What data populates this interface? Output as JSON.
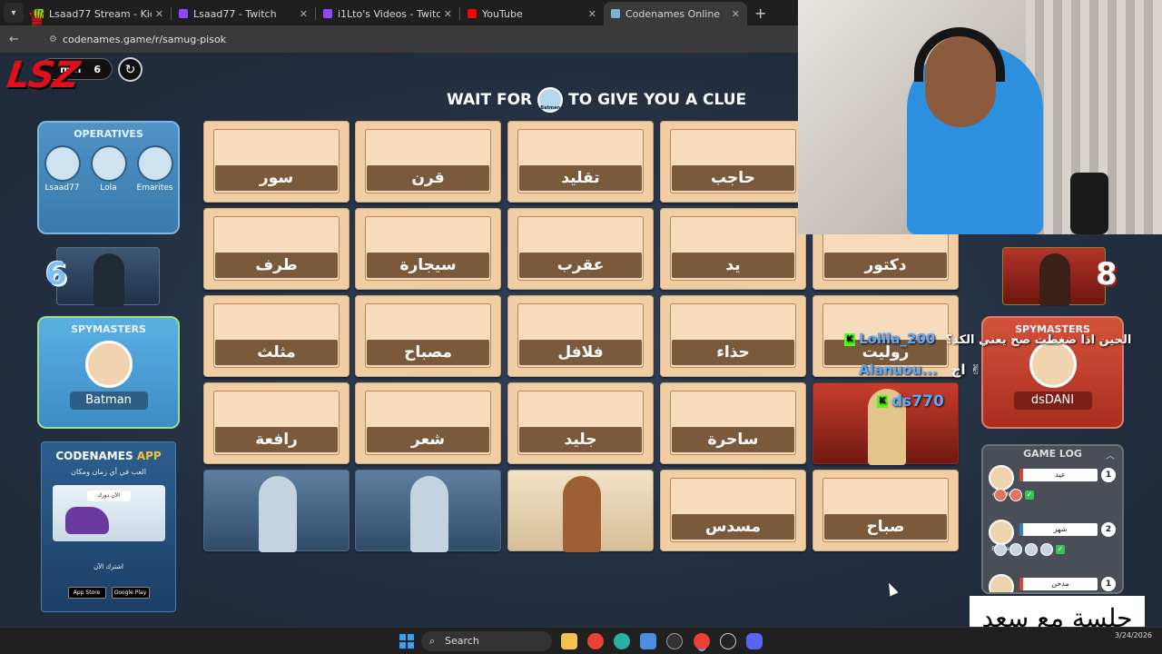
{
  "browser": {
    "tabs": [
      {
        "label": "Lsaad77 Stream - Kick Dashboo",
        "color": "#53fc18",
        "active": false
      },
      {
        "label": "Lsaad77 - Twitch",
        "color": "#9146ff",
        "active": false
      },
      {
        "label": "i1Lto's Videos - Twitch",
        "color": "#9146ff",
        "active": false
      },
      {
        "label": "YouTube",
        "color": "#ff0000",
        "active": false
      },
      {
        "label": "Codenames Online",
        "color": "#7bb3d6",
        "active": true
      }
    ],
    "url": "codenames.game/r/samug-pisok"
  },
  "stream_logo": "LSZ",
  "timer": {
    "label": "min",
    "value": "6"
  },
  "clue_banner": {
    "prefix": "WAIT FOR",
    "spymaster": "Batman",
    "suffix": "TO GIVE YOU A CLUE"
  },
  "blue_team": {
    "operatives_title": "OPERATIVES",
    "operatives": [
      "Lsaad77",
      "Lola",
      "Emarites"
    ],
    "score": "6",
    "spymasters_title": "SPYMASTERS",
    "spymaster": "Batman"
  },
  "red_team": {
    "score": "8",
    "spymasters_title": "SPYMASTERS",
    "spymaster": "dsDANI"
  },
  "promo": {
    "title_a": "CODENAMES",
    "title_b": "APP",
    "subtitle": "العب في أي زمان ومكان",
    "card_pill": "الآن دورك",
    "cta": "اشترك الآن",
    "store_a": "App Store",
    "store_b": "Google Play"
  },
  "cards": [
    [
      "سور",
      "قرن",
      "تقليد",
      "حاجب",
      ""
    ],
    [
      "طرف",
      "سيجارة",
      "عقرب",
      "يد",
      "دكتور"
    ],
    [
      "مثلث",
      "مصباح",
      "فلافل",
      "حذاء",
      "روليت"
    ],
    [
      "رافعة",
      "شعر",
      "جليد",
      "ساحرة",
      ""
    ],
    [
      "",
      "",
      "",
      "مسدس",
      "صباح"
    ]
  ],
  "chat": [
    {
      "user": "Lolila_200",
      "message": "الحين اذا ضغطت صح يعني الكد؟"
    },
    {
      "user": "Alanuou...",
      "message": "اح ✌"
    },
    {
      "user": "ds770",
      "message": ""
    }
  ],
  "game_log": {
    "title": "GAME LOG",
    "entries": [
      {
        "who": "dsDANI",
        "clue": "عيد",
        "num": "1",
        "team": "red"
      },
      {
        "who": "Batman",
        "clue": "شهر",
        "num": "2",
        "team": "blue"
      },
      {
        "who": "",
        "clue": "مدخن",
        "num": "1",
        "team": "red"
      }
    ]
  },
  "watermark": "جلسة مع سعد",
  "taskbar": {
    "search": "Search",
    "time": "3/24/2026"
  }
}
